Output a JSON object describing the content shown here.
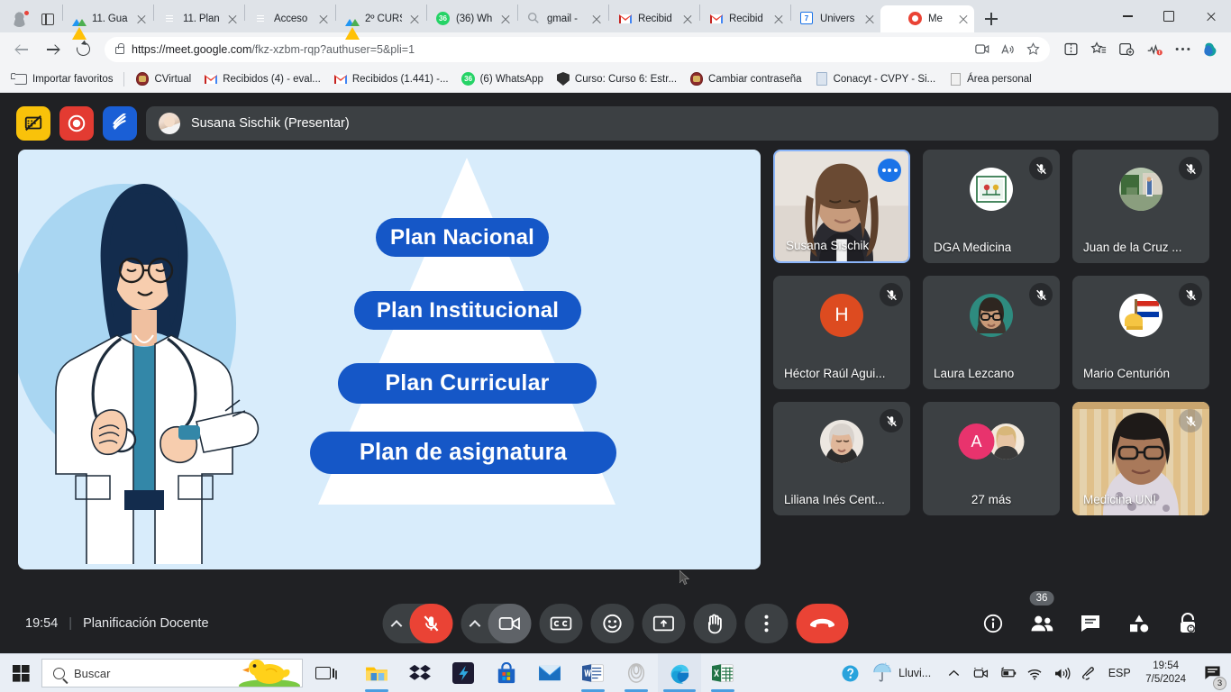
{
  "browser": {
    "tabs": [
      {
        "title": "11. Gua",
        "icon": "drive-icon",
        "active": false
      },
      {
        "title": "11. Plan",
        "icon": "docs-icon",
        "active": false
      },
      {
        "title": "Acceso",
        "icon": "docs-icon",
        "active": false
      },
      {
        "title": "2º CURS",
        "icon": "drive-icon",
        "active": false
      },
      {
        "title": "(36) Wh",
        "icon": "whatsapp-icon",
        "active": false
      },
      {
        "title": "gmail -",
        "icon": "search-icon",
        "active": false
      },
      {
        "title": "Recibid",
        "icon": "gmail-icon",
        "active": false
      },
      {
        "title": "Recibid",
        "icon": "gmail-icon",
        "active": false
      },
      {
        "title": "Univers",
        "icon": "calendar-icon",
        "active": false
      },
      {
        "title": "Me",
        "icon": "meet-icon",
        "active": true
      }
    ],
    "url_prefix": "https://meet.google.com",
    "url_path": "/fkz-xzbm-rqp?authuser=5&pli=1",
    "window_controls": {
      "minimize": "–",
      "maximize": "□",
      "close": "×"
    },
    "new_tab_label": "+",
    "bookmarks": [
      {
        "label": "Importar favoritos",
        "icon": "import-favorites-icon"
      },
      {
        "label": "CVirtual",
        "icon": "seal-icon"
      },
      {
        "label": "Recibidos (4) - eval...",
        "icon": "gmail-icon"
      },
      {
        "label": "Recibidos (1.441) -...",
        "icon": "gmail-icon"
      },
      {
        "label": "(6) WhatsApp",
        "icon": "whatsapp-icon"
      },
      {
        "label": "Curso: Curso 6: Estr...",
        "icon": "shield-icon"
      },
      {
        "label": "Cambiar contraseña",
        "icon": "seal-icon"
      },
      {
        "label": "Conacyt - CVPY - Si...",
        "icon": "document-icon"
      },
      {
        "label": "Área personal",
        "icon": "pdf-icon"
      }
    ]
  },
  "meet": {
    "extensions": [
      {
        "name": "screen-block-extension",
        "color": "#f9c20a"
      },
      {
        "name": "recorder-extension",
        "color": "#e33b32"
      },
      {
        "name": "annotate-extension",
        "color": "#1a5fd6"
      }
    ],
    "presenter": "Susana Sischik (Presentar)",
    "slide": {
      "steps": [
        "Plan Nacional",
        "Plan Institucional",
        "Plan Curricular",
        "Plan de asignatura"
      ],
      "background_color": "#d8ecfb",
      "step_color": "#1557c7"
    },
    "participants": [
      {
        "name": "Susana Sischik",
        "self": true,
        "muted": false,
        "video": true,
        "avatar_type": "video",
        "avatar_color": "#b28a6a"
      },
      {
        "name": "DGA Medicina",
        "self": false,
        "muted": true,
        "video": false,
        "avatar_type": "logo",
        "avatar_color": "#ffffff"
      },
      {
        "name": "Juan de la Cruz ...",
        "self": false,
        "muted": true,
        "video": false,
        "avatar_type": "photo",
        "avatar_color": "#5a7a52"
      },
      {
        "name": "Héctor Raúl Agui...",
        "self": false,
        "muted": true,
        "video": false,
        "avatar_type": "initial",
        "avatar_color": "#dd4b20",
        "initial": "H"
      },
      {
        "name": "Laura Lezcano",
        "self": false,
        "muted": true,
        "video": false,
        "avatar_type": "photo",
        "avatar_color": "#2e8b7f"
      },
      {
        "name": "Mario Centurión",
        "self": false,
        "muted": true,
        "video": false,
        "avatar_type": "flag",
        "avatar_color": "#ffffff"
      },
      {
        "name": "Liliana Inés Cent...",
        "self": false,
        "muted": true,
        "video": false,
        "avatar_type": "photo",
        "avatar_color": "#e0d6cc"
      },
      {
        "name": "27 más",
        "self": false,
        "muted": false,
        "video": false,
        "avatar_type": "group",
        "avatar_color": "#e8336d",
        "initial": "A"
      },
      {
        "name": "Medicina UNI",
        "self": false,
        "muted": true,
        "video": true,
        "avatar_type": "video",
        "avatar_color": "#c9a05e"
      }
    ],
    "bottom_bar": {
      "time": "19:54",
      "divider": "|",
      "meeting_title": "Planificación Docente",
      "controls": [
        {
          "name": "mic-toggle",
          "state": "muted",
          "icon": "mic-off-icon"
        },
        {
          "name": "camera-toggle",
          "state": "off",
          "icon": "video-off-icon"
        },
        {
          "name": "captions",
          "icon": "cc-icon"
        },
        {
          "name": "reactions",
          "icon": "emoji-icon"
        },
        {
          "name": "present-screen",
          "icon": "present-icon"
        },
        {
          "name": "raise-hand",
          "icon": "hand-icon"
        },
        {
          "name": "more-options",
          "icon": "more-vertical-icon"
        },
        {
          "name": "leave-call",
          "icon": "hangup-icon"
        }
      ],
      "right_controls": [
        {
          "name": "meeting-details",
          "icon": "info-icon",
          "badge": ""
        },
        {
          "name": "participants",
          "icon": "people-icon",
          "badge": "36"
        },
        {
          "name": "chat",
          "icon": "chat-icon",
          "badge": ""
        },
        {
          "name": "activities",
          "icon": "activities-icon",
          "badge": ""
        },
        {
          "name": "host-controls",
          "icon": "lock-icon",
          "badge": ""
        }
      ]
    }
  },
  "taskbar": {
    "search_placeholder": "Buscar",
    "apps": [
      {
        "name": "file-explorer",
        "open": true
      },
      {
        "name": "dropbox",
        "open": false
      },
      {
        "name": "photoshop-express",
        "open": false
      },
      {
        "name": "microsoft-store",
        "open": false
      },
      {
        "name": "mail",
        "open": false
      },
      {
        "name": "word",
        "open": true
      },
      {
        "name": "whiteboard",
        "open": true
      },
      {
        "name": "microsoft-edge",
        "open": true,
        "active": true
      },
      {
        "name": "excel",
        "open": true
      }
    ],
    "weather": "Lluvi...",
    "language": "ESP",
    "time": "19:54",
    "date": "7/5/2024",
    "notification_count": "3"
  }
}
